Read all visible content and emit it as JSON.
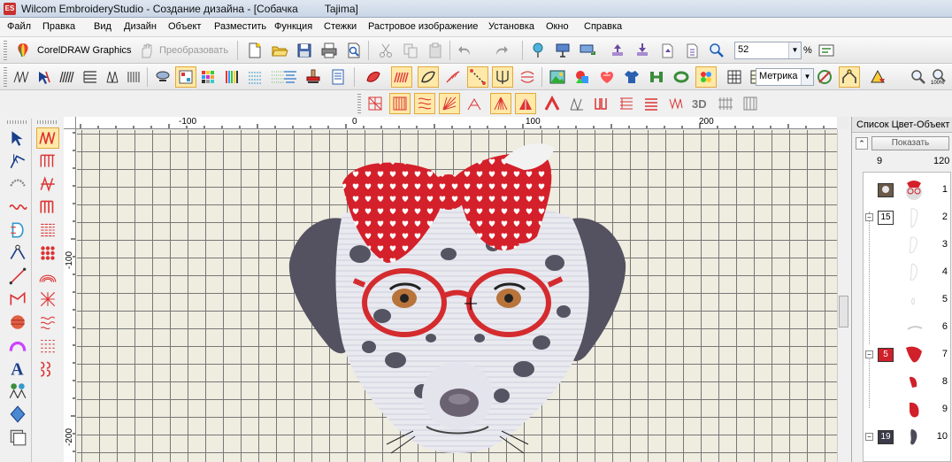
{
  "window": {
    "title": "Wilcom EmbroideryStudio - Создание дизайна - [Собачка         Tajima]",
    "app_icon": "ES"
  },
  "menu": {
    "items": [
      "Файл",
      "Правка",
      "Вид",
      "Дизайн",
      "Объект",
      "Разместить",
      "Функция",
      "Стежки",
      "Растровое изображение",
      "Установка",
      "Окно",
      "Справка"
    ]
  },
  "toolbar": {
    "coreldraw_label": "CorelDRAW Graphics",
    "convert_label": "Преобразовать",
    "zoom_value": "52",
    "zoom_unit": "%",
    "units_value": "Метрика",
    "zoom_100_label": "100%"
  },
  "ruler": {
    "top_labels": [
      "-100",
      "0",
      "100",
      "200"
    ],
    "left_labels": [
      "-100",
      "-200"
    ]
  },
  "right_panel": {
    "title": "Список Цвет-Объект",
    "show_button": "Показать",
    "col_left": "9",
    "col_right": "120",
    "rows": [
      {
        "num": "1",
        "swatch": "",
        "color": "",
        "thumb": "dog"
      },
      {
        "num": "2",
        "swatch": "15",
        "color": "#ffffff",
        "thumb": "white"
      },
      {
        "num": "3",
        "swatch": "",
        "color": "",
        "thumb": "white"
      },
      {
        "num": "4",
        "swatch": "",
        "color": "",
        "thumb": "white"
      },
      {
        "num": "5",
        "swatch": "",
        "color": "",
        "thumb": "white-small"
      },
      {
        "num": "6",
        "swatch": "",
        "color": "",
        "thumb": "white-line"
      },
      {
        "num": "7",
        "swatch": "5",
        "color": "#d0202a",
        "thumb": "red"
      },
      {
        "num": "8",
        "swatch": "",
        "color": "",
        "thumb": "red-small"
      },
      {
        "num": "9",
        "swatch": "",
        "color": "",
        "thumb": "red"
      },
      {
        "num": "10",
        "swatch": "19",
        "color": "#3a3a48",
        "thumb": "gray"
      }
    ]
  },
  "colors": {
    "accent_red": "#d0202a",
    "canvas_bg": "#efece0",
    "grid_line": "#777777",
    "selected_tool": "#ffe9a8"
  }
}
